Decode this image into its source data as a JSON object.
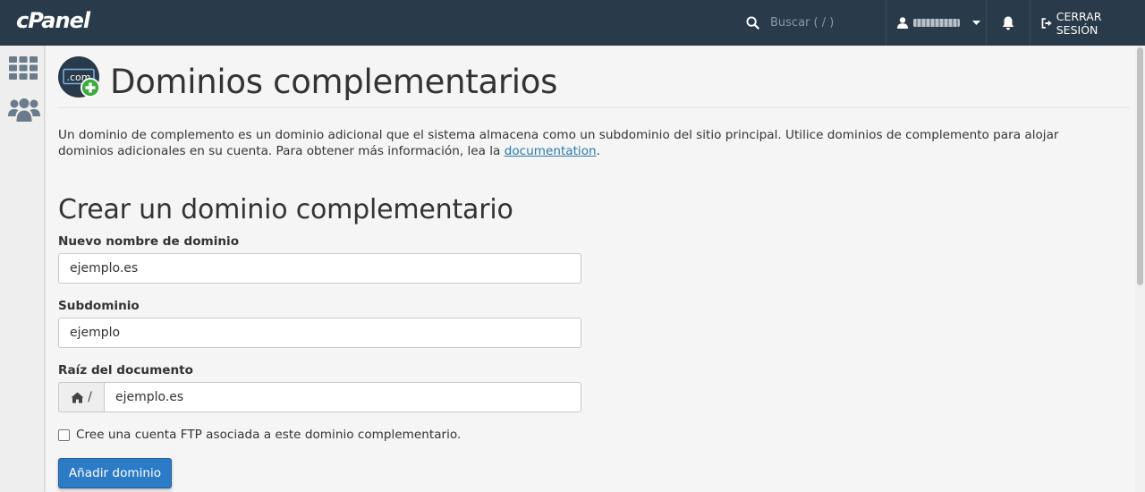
{
  "header": {
    "logo_text": "cPanel",
    "search_placeholder": "Buscar ( / )",
    "logout_label": "CERRAR SESIÓN"
  },
  "sidebar": {
    "items": [
      {
        "icon": "grid-icon"
      },
      {
        "icon": "users-icon"
      }
    ]
  },
  "page": {
    "icon": "domain-add-icon",
    "icon_text": ".com",
    "title": "Dominios complementarios",
    "intro_text": "Un dominio de complemento es un dominio adicional que el sistema almacena como un subdominio del sitio principal. Utilice dominios de complemento para alojar dominios adicionales en su cuenta. Para obtener más información, lea la ",
    "intro_link": "documentation",
    "intro_end": "."
  },
  "form": {
    "section_title": "Crear un dominio complementario",
    "domain_label": "Nuevo nombre de dominio",
    "domain_value": "ejemplo.es",
    "subdomain_label": "Subdominio",
    "subdomain_value": "ejemplo",
    "docroot_label": "Raíz del documento",
    "docroot_prefix": "/",
    "docroot_value": "ejemplo.es",
    "ftp_checkbox_label": "Cree una cuenta FTP asociada a este dominio complementario.",
    "ftp_checked": false,
    "submit_label": "Añadir dominio"
  },
  "colors": {
    "topbar": "#293a4a",
    "primary_button": "#2c7bc7",
    "link": "#2a7ab0",
    "icon_add": "#3dab3d"
  }
}
